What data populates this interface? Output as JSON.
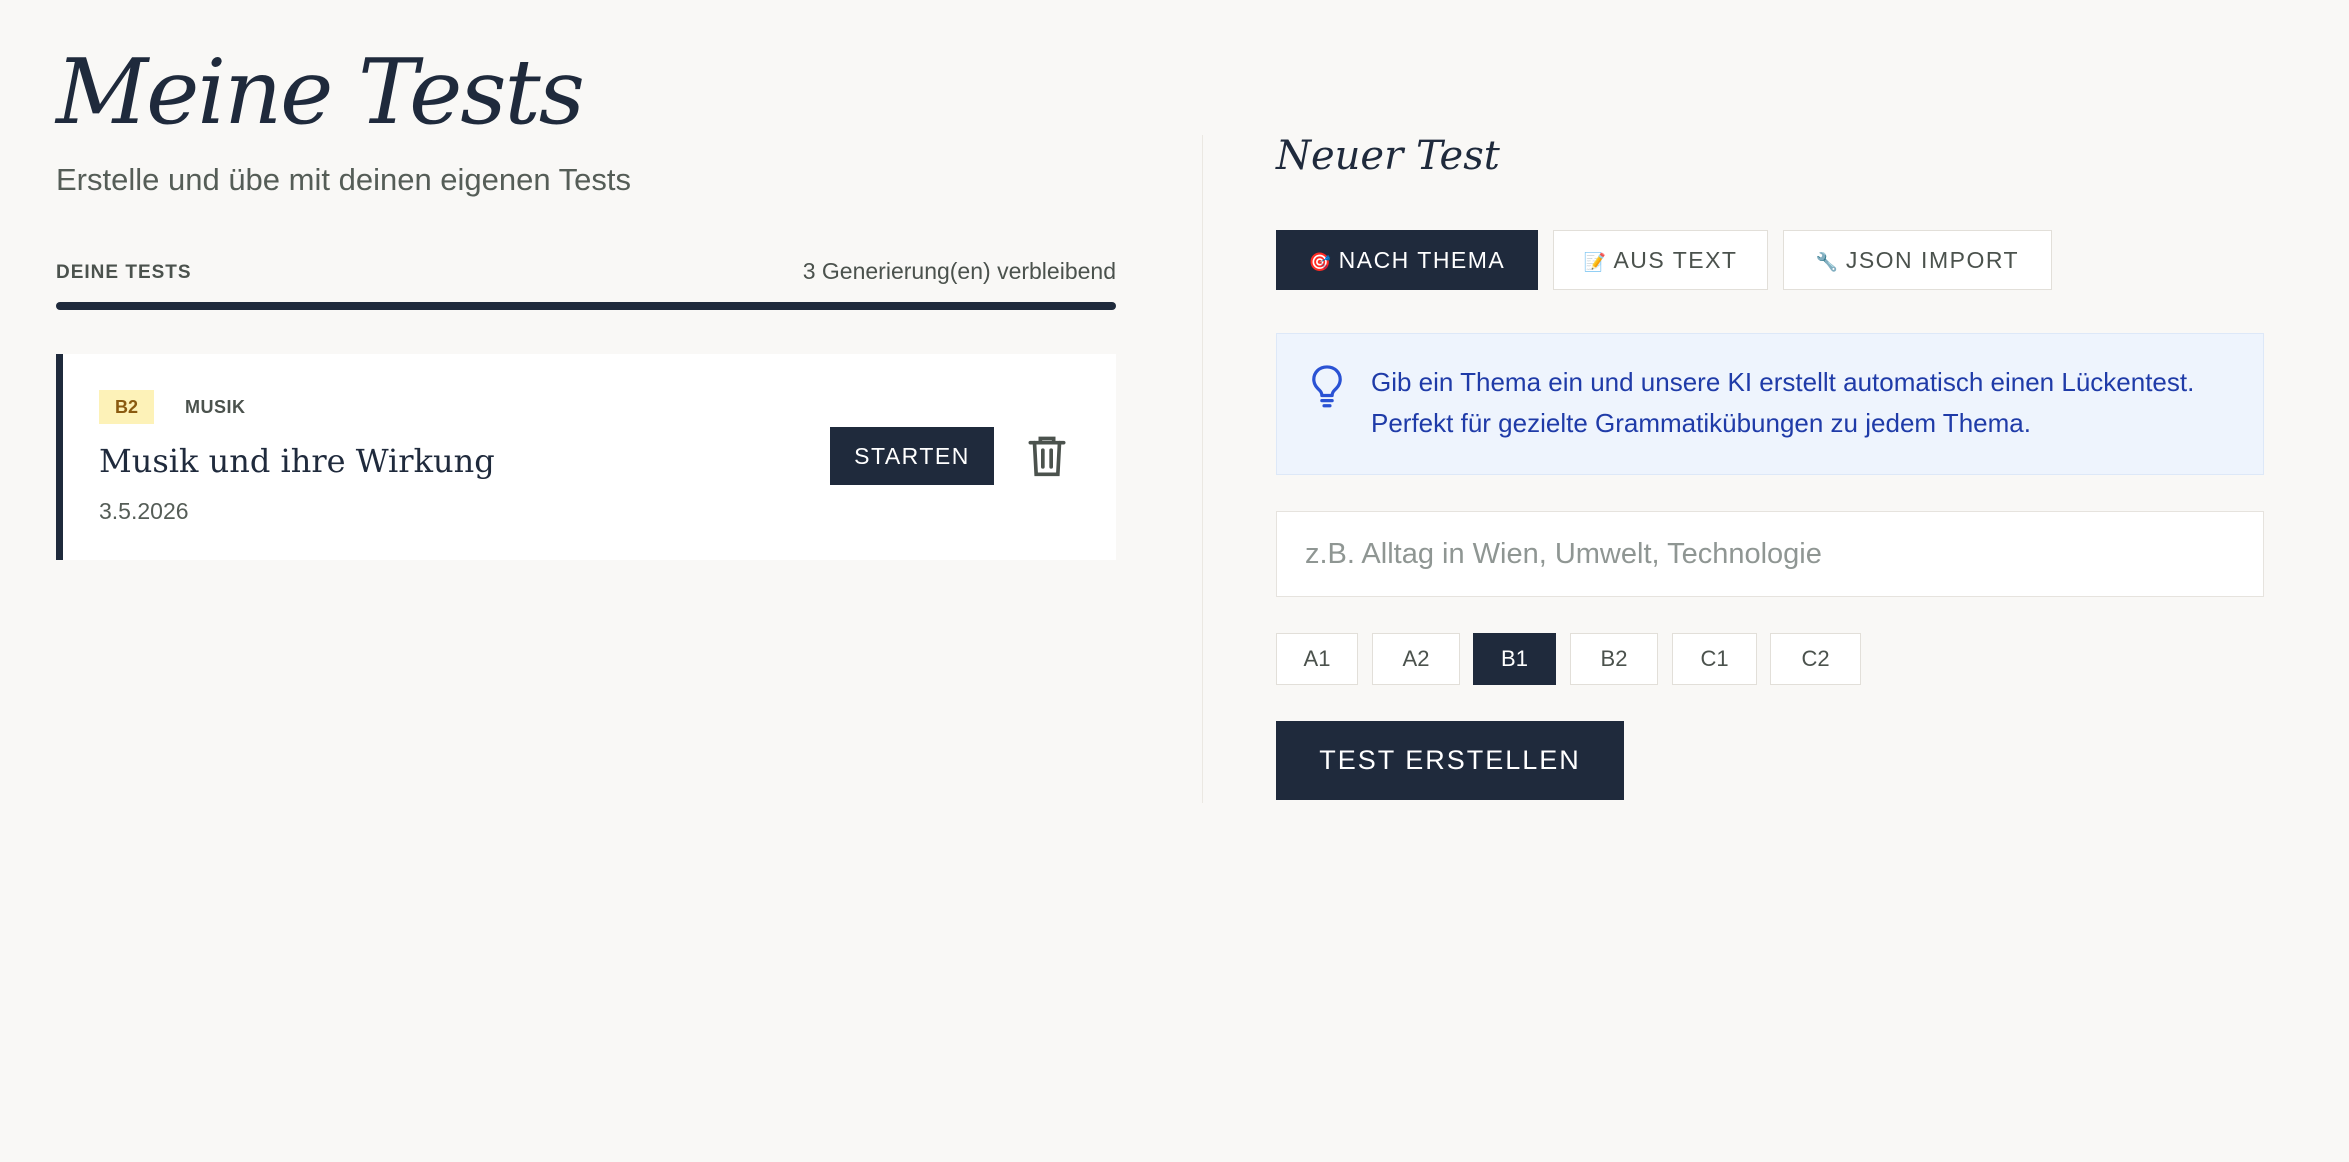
{
  "header": {
    "title": "Meine Tests",
    "subtitle": "Erstelle und übe mit deinen eigenen Tests"
  },
  "tests": {
    "section_label": "DEINE TESTS",
    "remaining": "3 Generierung(en) verbleibend",
    "items": [
      {
        "level": "B2",
        "topic": "MUSIK",
        "title": "Musik und ihre Wirkung",
        "date": "3.5.2026",
        "start_label": "STARTEN",
        "delete_icon": "trash-icon"
      }
    ]
  },
  "new_test": {
    "title": "Neuer Test",
    "tabs": [
      {
        "icon": "🎯",
        "label": "NACH THEMA",
        "active": true
      },
      {
        "icon": "📝",
        "label": "AUS TEXT",
        "active": false
      },
      {
        "icon": "🔧",
        "label": "JSON IMPORT",
        "active": false
      }
    ],
    "info": {
      "icon": "lightbulb-icon",
      "text": "Gib ein Thema ein und unsere KI erstellt automatisch einen Lückentest. Perfekt für gezielte Grammatikübungen zu jedem Thema."
    },
    "topic_input": {
      "placeholder": "z.B. Alltag in Wien, Umwelt, Technologie",
      "value": ""
    },
    "levels": [
      "A1",
      "A2",
      "B1",
      "B2",
      "C1",
      "C2"
    ],
    "selected_level": "B1",
    "create_label": "TEST ERSTELLEN"
  },
  "colors": {
    "background": "#f9f8f6",
    "primary": "#1f2a3c",
    "info_bg": "#eef4fd",
    "info_text": "#1f3ba8",
    "badge_bg": "#fdf2b8",
    "badge_text": "#8a5a10"
  }
}
